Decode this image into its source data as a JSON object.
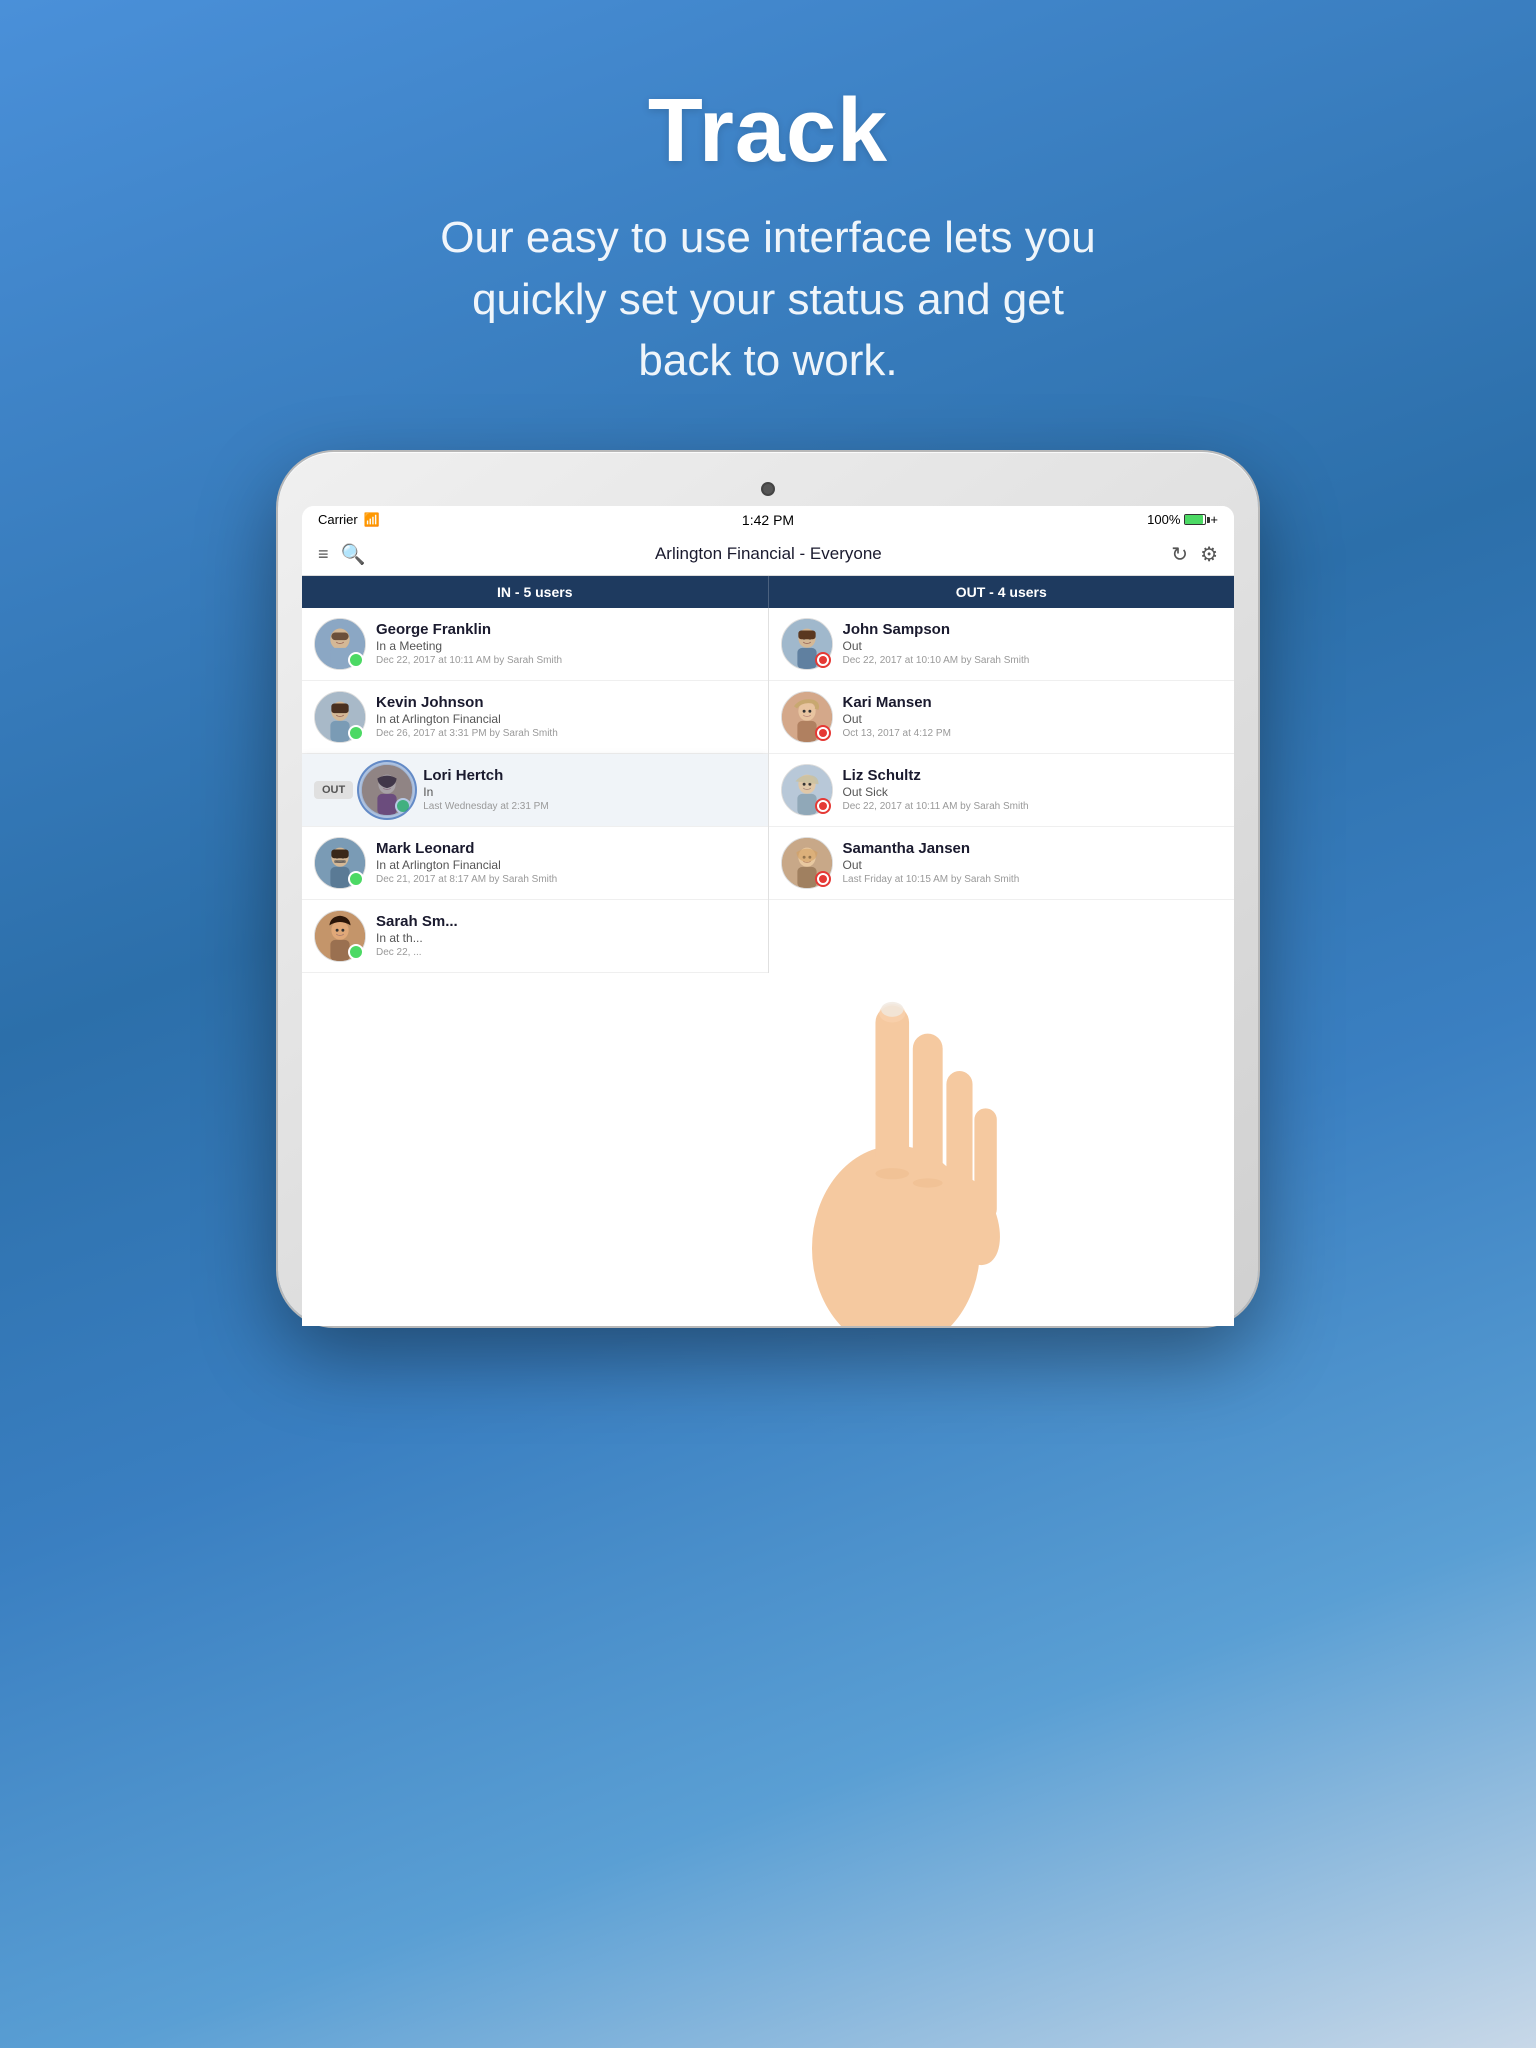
{
  "page": {
    "title": "Track",
    "subtitle": "Our easy to use interface lets you quickly set your status and get back to work.",
    "bg_gradient_start": "#4a90d9",
    "bg_gradient_end": "#2c6faa"
  },
  "status_bar": {
    "carrier": "Carrier",
    "time": "1:42 PM",
    "battery": "100%"
  },
  "app_nav": {
    "title": "Arlington Financial - Everyone"
  },
  "tabs": {
    "in_label": "IN - 5 users",
    "out_label": "OUT - 4 users"
  },
  "in_users": [
    {
      "name": "George Franklin",
      "status": "In a Meeting",
      "time": "Dec 22, 2017 at 10:11 AM by Sarah Smith",
      "avatar_color": "george",
      "status_type": "green"
    },
    {
      "name": "Kevin Johnson",
      "status": "In at Arlington Financial",
      "time": "Dec 26, 2017 at 3:31 PM by Sarah Smith",
      "avatar_color": "kevin",
      "status_type": "green"
    },
    {
      "name": "Lori Hertch",
      "status": "In",
      "time": "Last Wednesday at 2:31 PM",
      "avatar_color": "lori",
      "status_type": "green",
      "selected": true,
      "out_badge": "OUT"
    },
    {
      "name": "Mark Leonard",
      "status": "In at Arlington Financial",
      "time": "Dec 21, 2017 at 8:17 AM by Sarah Smith",
      "avatar_color": "mark",
      "status_type": "green"
    },
    {
      "name": "Sarah Smith",
      "status": "In at th...",
      "time": "Dec 22, ...",
      "avatar_color": "sarah",
      "status_type": "green"
    }
  ],
  "out_users": [
    {
      "name": "John Sampson",
      "status": "Out",
      "time": "Dec 22, 2017 at 10:10 AM by Sarah Smith",
      "avatar_color": "john",
      "status_type": "red"
    },
    {
      "name": "Kari Mansen",
      "status": "Out",
      "time": "Oct 13, 2017 at 4:12 PM",
      "avatar_color": "kari",
      "status_type": "red"
    },
    {
      "name": "Liz Schultz",
      "status": "Out Sick",
      "time": "Dec 22, 2017 at 10:11 AM by Sarah Smith",
      "avatar_color": "liz",
      "status_type": "red"
    },
    {
      "name": "Samantha Jansen",
      "status": "Out",
      "time": "Last Friday at 10:15 AM by Sarah Smith",
      "avatar_color": "samantha",
      "status_type": "red"
    }
  ],
  "icons": {
    "filter": "≡",
    "search": "⌕",
    "refresh": "↻",
    "settings": "⚙",
    "wifi": "WiFi"
  }
}
